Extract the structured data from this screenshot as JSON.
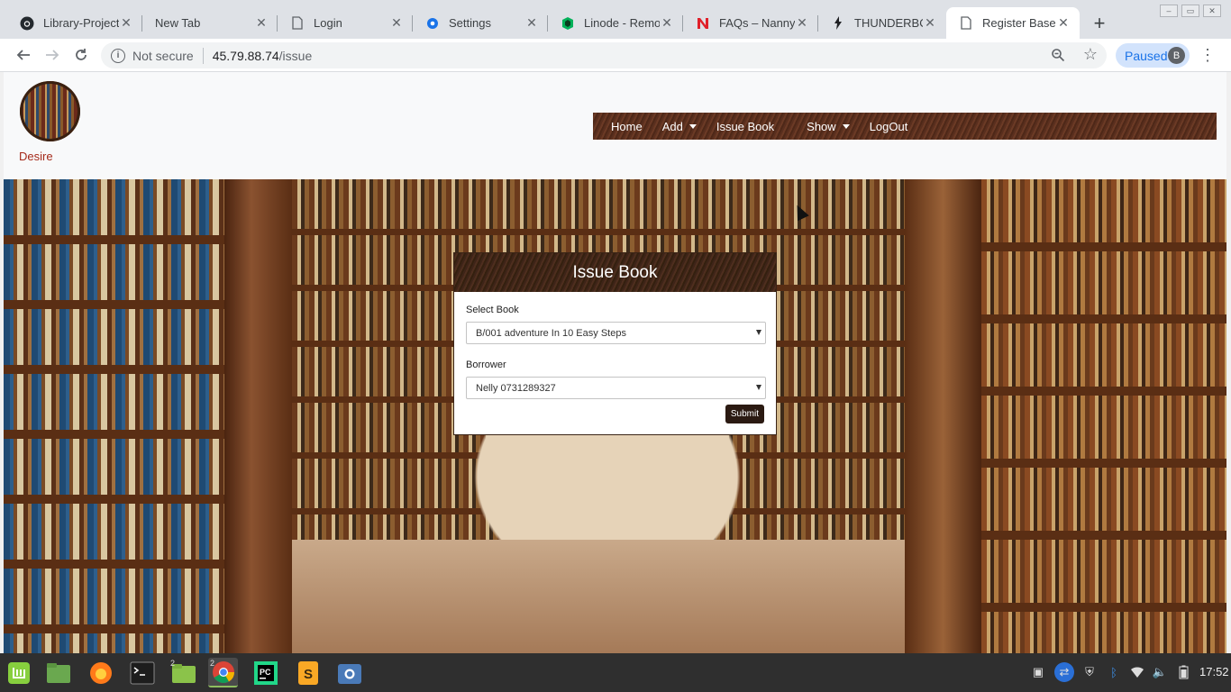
{
  "browser": {
    "tabs": [
      {
        "label": "Library-Project",
        "icon": "github-icon"
      },
      {
        "label": "New Tab",
        "icon": ""
      },
      {
        "label": "Login",
        "icon": "page-icon"
      },
      {
        "label": "Settings",
        "icon": "gear-icon"
      },
      {
        "label": "Linode - Remot",
        "icon": "linode-icon"
      },
      {
        "label": "FAQs – Nanny S",
        "icon": "n-logo-icon"
      },
      {
        "label": "THUNDERBOL",
        "icon": "bolt-icon"
      },
      {
        "label": "Register Base",
        "icon": "page-icon"
      }
    ],
    "active_tab_index": 7,
    "new_tab_label": "+",
    "security_label": "Not secure",
    "url_host": "45.79.88.74",
    "url_path": "/issue",
    "profile_status": "Paused",
    "profile_initial": "B"
  },
  "site": {
    "username": "Desire",
    "nav": {
      "home": "Home",
      "add": "Add",
      "issue_book": "Issue Book",
      "show": "Show",
      "logout": "LogOut"
    }
  },
  "form": {
    "title": "Issue Book",
    "book_label": "Select Book",
    "book_value": "B/001 adventure In 10 Easy Steps",
    "borrower_label": "Borrower",
    "borrower_value": "Nelly 0731289327",
    "submit_label": "Submit"
  },
  "taskbar": {
    "apps": [
      "mint-menu-icon",
      "files-icon",
      "firefox-icon",
      "terminal-icon",
      "folder-icon",
      "chrome-icon",
      "pycharm-icon",
      "sublime-icon",
      "screenshot-icon"
    ],
    "folder_badge": "2",
    "chrome_badge": "2",
    "clock": "17:52"
  },
  "colors": {
    "nav_bg": "#5a2f1e",
    "username": "#a52a1a",
    "submit_bg": "#2b1a12",
    "paused_bg": "#d2e3fc"
  }
}
